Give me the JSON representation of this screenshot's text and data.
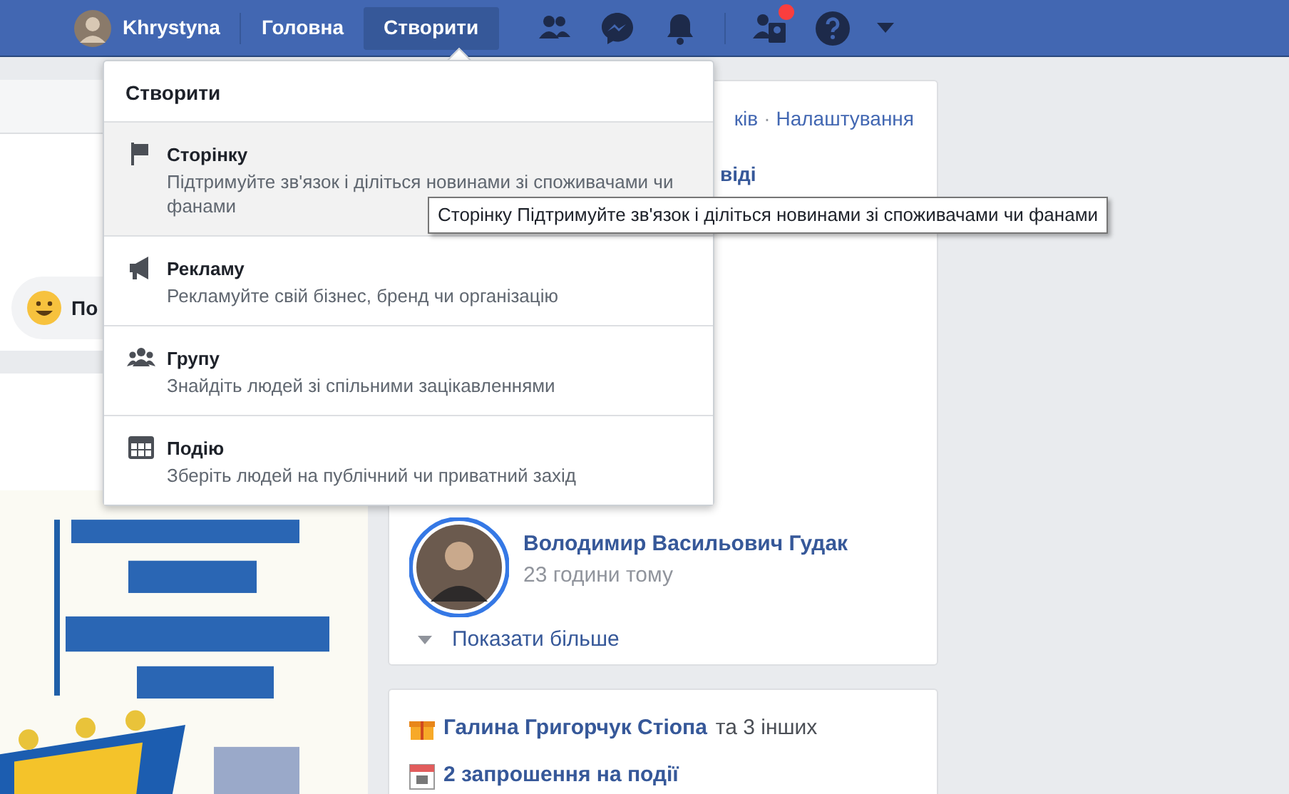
{
  "navbar": {
    "user": "Khrystyna",
    "links": [
      {
        "label": "Головна",
        "selected": false
      },
      {
        "label": "Створити",
        "selected": true
      }
    ],
    "notification_badge": true
  },
  "left_column": {
    "composer_partial": "По"
  },
  "right_card": {
    "header_fragment": "ків",
    "separator": "·",
    "settings_link": "Налаштування",
    "title_fragment": "віді",
    "person": "Володимир Васильович Гудак",
    "time": "23 години тому",
    "show_more": "Показати більше"
  },
  "events_card": {
    "birthday": {
      "names": "Галина Григорчук Стіопа",
      "rest": "та 3 інших"
    },
    "invites": "2 запрошення на події"
  },
  "create_menu": {
    "title": "Створити",
    "items": [
      {
        "kind": "page",
        "label": "Сторінку",
        "description": "Підтримуйте зв'язок і діліться новинами зі споживачами чи фанами",
        "highlighted": true
      },
      {
        "kind": "ad",
        "label": "Рекламу",
        "description": "Рекламуйте свій бізнес, бренд чи організацію",
        "highlighted": false
      },
      {
        "kind": "group",
        "label": "Групу",
        "description": "Знайдіть людей зі спільними зацікавленнями",
        "highlighted": false
      },
      {
        "kind": "event",
        "label": "Подію",
        "description": "Зберіть людей на публічний чи приватний захід",
        "highlighted": false
      }
    ]
  },
  "tooltip": "Сторінку Підтримуйте зв'язок і діліться новинами зі споживачами чи фанами"
}
